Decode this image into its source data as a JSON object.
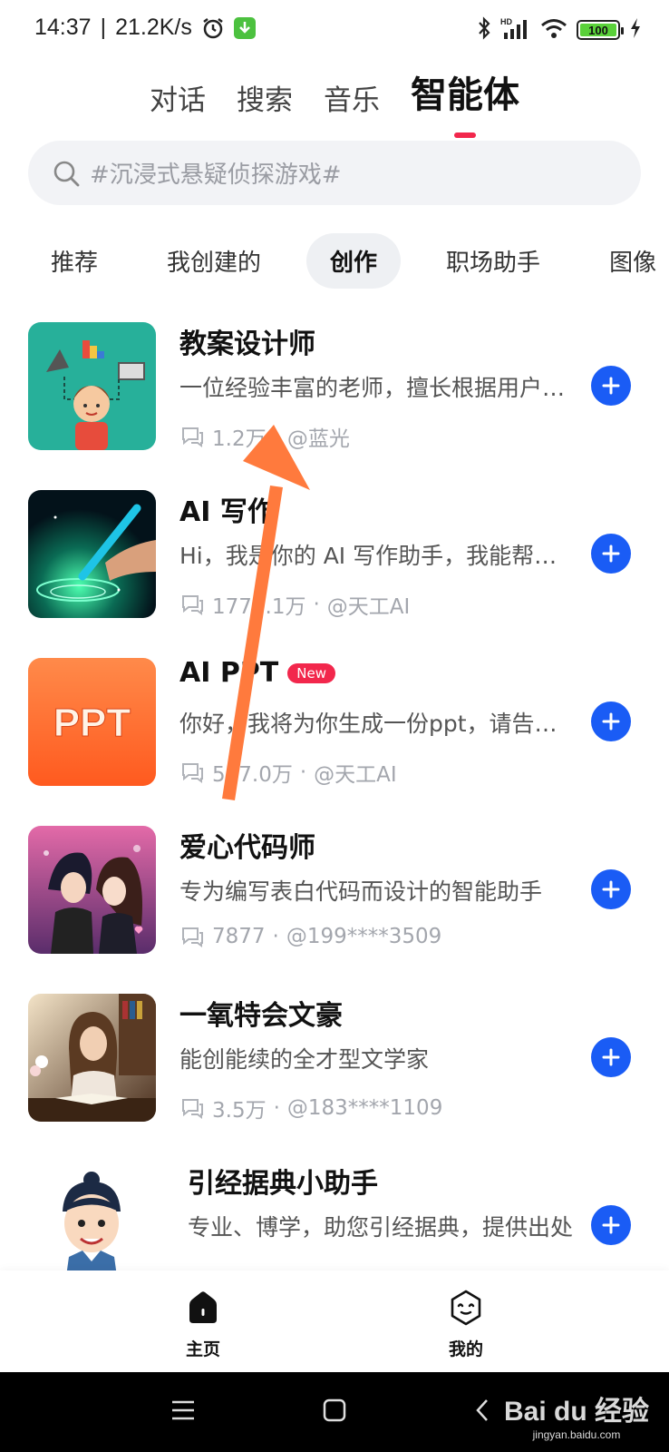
{
  "status_bar": {
    "time": "14:37",
    "speed": "21.2K/s",
    "network": "HD",
    "battery": "100"
  },
  "top_tabs": [
    {
      "label": "对话",
      "active": false
    },
    {
      "label": "搜索",
      "active": false
    },
    {
      "label": "音乐",
      "active": false
    },
    {
      "label": "智能体",
      "active": true
    }
  ],
  "search": {
    "placeholder": "#沉浸式悬疑侦探游戏#"
  },
  "categories": [
    {
      "label": "推荐",
      "active": false
    },
    {
      "label": "我创建的",
      "active": false
    },
    {
      "label": "创作",
      "active": true
    },
    {
      "label": "职场助手",
      "active": false
    },
    {
      "label": "图像",
      "active": false
    },
    {
      "label": "💪",
      "active": false
    }
  ],
  "agents": [
    {
      "title": "教案设计师",
      "badge": "",
      "desc": "一位经验丰富的老师，擅长根据用户需求设计教案",
      "count": "1.2万",
      "author": "@蓝光"
    },
    {
      "title": "AI 写作",
      "badge": "",
      "desc": "Hi，我是你的 AI 写作助手，我能帮你写作",
      "count": "1772.1万",
      "author": "@天工AI"
    },
    {
      "title": "AI PPT",
      "badge": "New",
      "desc": "你好，我将为你生成一份ppt，请告诉我主题",
      "count": "547.0万",
      "author": "@天工AI"
    },
    {
      "title": "爱心代码师",
      "badge": "",
      "desc": "专为编写表白代码而设计的智能助手",
      "count": "7877",
      "author": "@199****3509"
    },
    {
      "title": "一氧特会文豪",
      "badge": "",
      "desc": "能创能续的全才型文学家",
      "count": "3.5万",
      "author": "@183****1109"
    },
    {
      "title": "引经据典小助手",
      "badge": "",
      "desc": "专业、博学，助您引经据典，提供出处",
      "count": "",
      "author": ""
    }
  ],
  "bottom_nav": [
    {
      "label": "主页",
      "icon": "home-icon",
      "active": true
    },
    {
      "label": "我的",
      "icon": "profile-face-icon",
      "active": false
    }
  ],
  "watermark": {
    "main": "Bai du 经验",
    "sub": "jingyan.baidu.com"
  },
  "colors": {
    "accent": "#1a5cf5",
    "tab_indicator": "#f2274c",
    "annotation_arrow": "#ff7a3d"
  }
}
